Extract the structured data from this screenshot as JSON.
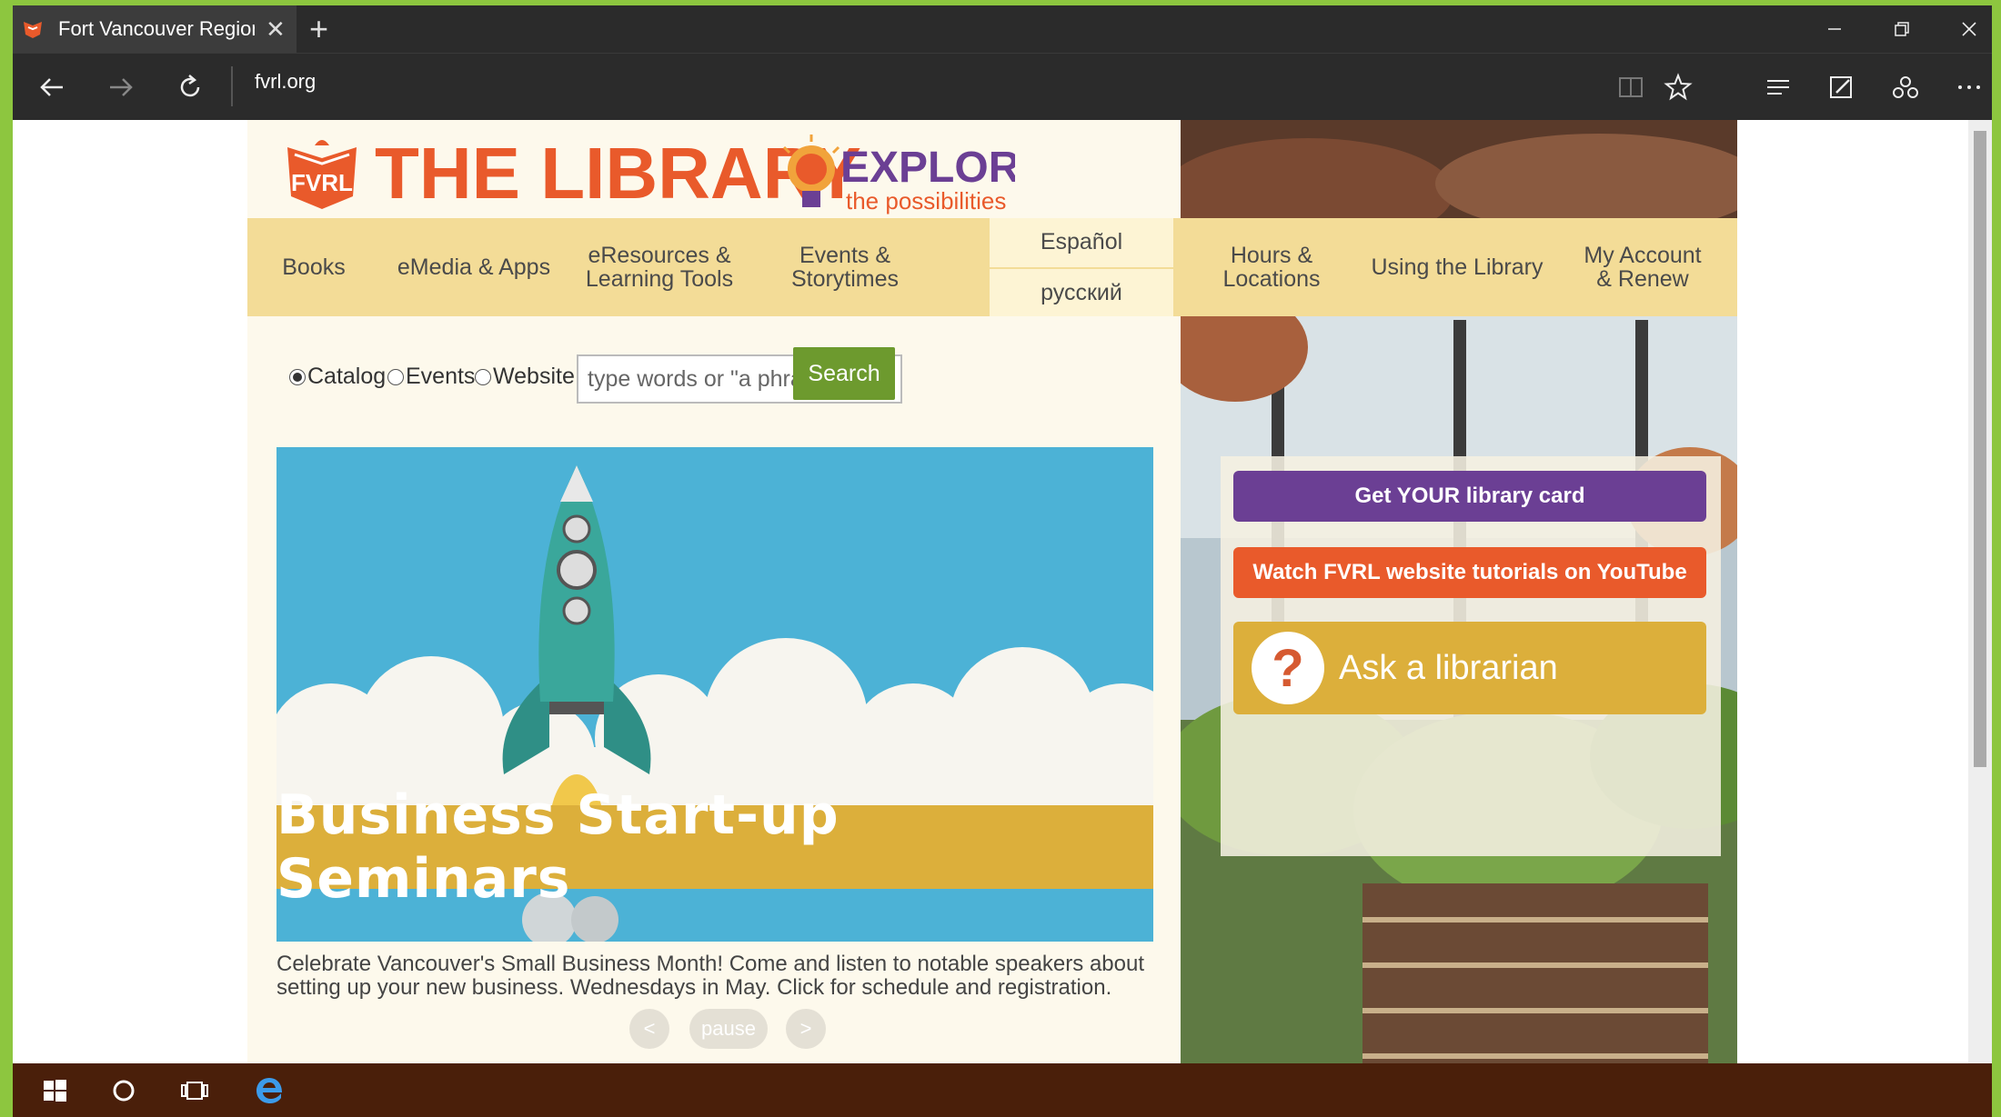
{
  "browser": {
    "tab_title": "Fort Vancouver Regiona",
    "new_tab": "+",
    "close_tab": "✕",
    "url": "fvrl.org"
  },
  "logo": {
    "badge": "FVRL",
    "title": "THE LIBRARY",
    "explore": "EXPLORE",
    "tagline": "the possibilities"
  },
  "nav": {
    "books": "Books",
    "emedia": "eMedia & Apps",
    "eresources_1": "eResources &",
    "eresources_2": "Learning Tools",
    "events_1": "Events &",
    "events_2": "Storytimes",
    "lang_es": "Español",
    "lang_ru": "русский",
    "hours": "Hours & Locations",
    "using": "Using the Library",
    "account_1": "My Account",
    "account_2": "& Renew"
  },
  "search": {
    "options": [
      "Catalog",
      "Events",
      "Website"
    ],
    "selected": "Catalog",
    "placeholder": "type words or \"a phrase\"",
    "button": "Search"
  },
  "banner": {
    "caption": "Business Start-up Seminars",
    "description": "Celebrate Vancouver's Small Business Month! Come and listen to notable speakers about setting up your new business. Wednesdays in May. Click for schedule and registration."
  },
  "carousel": {
    "prev": "<",
    "pause": "pause",
    "next": ">"
  },
  "sidebar": {
    "card_button": "Get YOUR library card",
    "youtube_button": "Watch FVRL website tutorials on YouTube",
    "ask_icon": "?",
    "ask_button": "Ask a librarian"
  },
  "colors": {
    "brand_orange": "#e95a2b",
    "nav_gold": "#f3dc97",
    "search_green": "#6d9a2e",
    "purple": "#6b3f94",
    "gold": "#dcaf3b",
    "sky": "#4cb2d6"
  }
}
